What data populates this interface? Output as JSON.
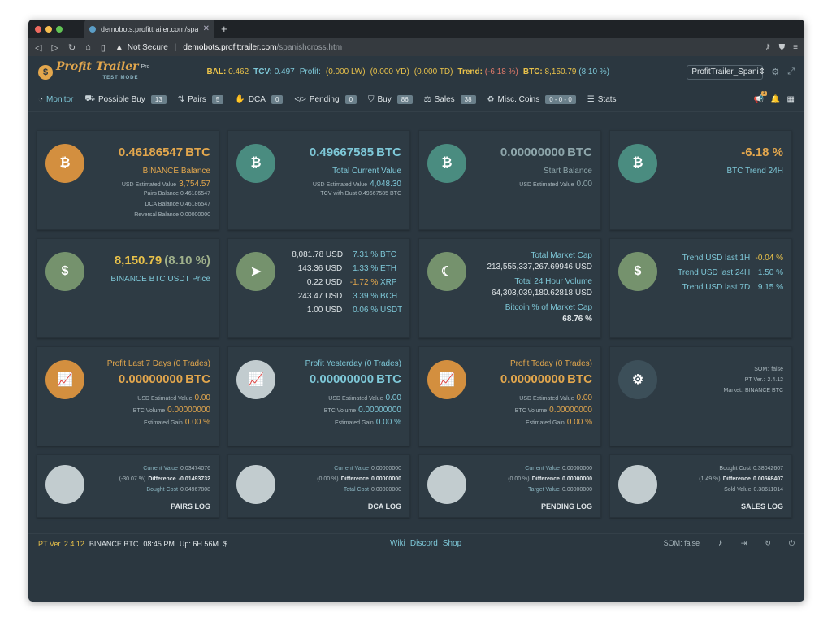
{
  "browser": {
    "tab_title": "demobots.profittrailer.com/spanis",
    "url_security": "Not Secure",
    "url_host": "demobots.profittrailer.com",
    "url_path": "/spanishcross.htm"
  },
  "header": {
    "logo_text": "Profit Trailer",
    "logo_pro": "Pro",
    "logo_sub": "TEST MODE",
    "bal_label": "BAL:",
    "bal_value": "0.462",
    "tcv_label": "TCV:",
    "tcv_value": "0.497",
    "profit_label": "Profit:",
    "profit_lw": "(0.000 LW)",
    "profit_yd": "(0.000 YD)",
    "profit_td": "(0.000 TD)",
    "trend_label": "Trend:",
    "trend_value": "(-6.18 %)",
    "btc_label": "BTC:",
    "btc_value": "8,150.79",
    "btc_change": "(8.10 %)",
    "config_select": "ProfitTrailer_Spani"
  },
  "nav": {
    "monitor": "Monitor",
    "possible_buy": "Possible Buy",
    "possible_buy_count": "13",
    "pairs": "Pairs",
    "pairs_count": "5",
    "dca": "DCA",
    "dca_count": "0",
    "pending": "Pending",
    "pending_count": "0",
    "buy": "Buy",
    "buy_count": "86",
    "sales": "Sales",
    "sales_count": "38",
    "misc": "Misc. Coins",
    "misc_count": "0 - 0 - 0",
    "stats": "Stats",
    "notif_count": "1"
  },
  "cards": {
    "binance": {
      "value": "0.46186547",
      "unit": "BTC",
      "label": "BINANCE Balance",
      "usd_label": "USD Estimated Value",
      "usd_value": "3,754.57",
      "pairs_line": "Pairs Balance 0.46186547",
      "dca_line": "DCA Balance 0.46186547",
      "reversal_line": "Reversal Balance 0.00000000"
    },
    "total": {
      "value": "0.49667585",
      "unit": "BTC",
      "label": "Total Current Value",
      "usd_label": "USD Estimated Value",
      "usd_value": "4,048.30",
      "dust_line": "TCV with Dust 0.49667585 BTC"
    },
    "start": {
      "value": "0.00000000",
      "unit": "BTC",
      "label": "Start Balance",
      "usd_label": "USD Estimated Value",
      "usd_value": "0.00"
    },
    "trend": {
      "value": "-6.18 %",
      "label": "BTC Trend 24H"
    },
    "btcprice": {
      "value": "8,150.79",
      "change": "(8.10 %)",
      "label": "BINANCE BTC USDT Price"
    },
    "market": {
      "rows": [
        {
          "usd": "8,081.78 USD",
          "pct": "7.31 %",
          "coin": "BTC"
        },
        {
          "usd": "143.36 USD",
          "pct": "1.33 %",
          "coin": "ETH"
        },
        {
          "usd": "0.22 USD",
          "pct": "-1.72 %",
          "coin": "XRP"
        },
        {
          "usd": "243.47 USD",
          "pct": "3.39 %",
          "coin": "BCH"
        },
        {
          "usd": "1.00 USD",
          "pct": "0.06 %",
          "coin": "USDT"
        }
      ]
    },
    "cap": {
      "label1": "Total Market Cap",
      "value1": "213,555,337,267.69946 USD",
      "label2": "Total 24 Hour Volume",
      "value2": "64,303,039,180.62818 USD",
      "label3": "Bitcoin % of Market Cap",
      "value3": "68.76 %"
    },
    "trendusd": {
      "rows": [
        {
          "label": "Trend USD last 1H",
          "value": "-0.04 %"
        },
        {
          "label": "Trend USD last 24H",
          "value": "1.50 %"
        },
        {
          "label": "Trend USD last 7D",
          "value": "9.15 %"
        }
      ]
    },
    "profit7": {
      "title": "Profit Last 7 Days (0 Trades)",
      "value": "0.00000000",
      "unit": "BTC",
      "usd_label": "USD Estimated Value",
      "usd_value": "0.00",
      "vol_label": "BTC Volume",
      "vol_value": "0.00000000",
      "gain_label": "Estimated Gain",
      "gain_value": "0.00 %"
    },
    "profityd": {
      "title": "Profit Yesterday (0 Trades)",
      "value": "0.00000000",
      "unit": "BTC",
      "usd_label": "USD Estimated Value",
      "usd_value": "0.00",
      "vol_label": "BTC Volume",
      "vol_value": "0.00000000",
      "gain_label": "Estimated Gain",
      "gain_value": "0.00 %"
    },
    "profittd": {
      "title": "Profit Today (0 Trades)",
      "value": "0.00000000",
      "unit": "BTC",
      "usd_label": "USD Estimated Value",
      "usd_value": "0.00",
      "vol_label": "BTC Volume",
      "vol_value": "0.00000000",
      "gain_label": "Estimated Gain",
      "gain_value": "0.00 %"
    },
    "settings": {
      "som_label": "SOM:",
      "som_value": "false",
      "ver_label": "PT Ver.:",
      "ver_value": "2.4.12",
      "market_label": "Market:",
      "market_value": "BINANCE BTC"
    },
    "pairslog": {
      "cv_label": "Current Value",
      "cv_value": "0.03474076",
      "pct": "(-30.07 %)",
      "diff_label": "Difference",
      "diff_value": "-0.01493732",
      "cost_label": "Bought Cost",
      "cost_value": "0.04967808",
      "title": "PAIRS LOG"
    },
    "dcalog": {
      "cv_label": "Current Value",
      "cv_value": "0.00000000",
      "pct": "(0.00 %)",
      "diff_label": "Difference",
      "diff_value": "0.00000000",
      "cost_label": "Total Cost",
      "cost_value": "0.00000000",
      "title": "DCA LOG"
    },
    "pendinglog": {
      "cv_label": "Current Value",
      "cv_value": "0.00000000",
      "pct": "(0.00 %)",
      "diff_label": "Difference",
      "diff_value": "0.00000000",
      "cost_label": "Target Value",
      "cost_value": "0.00000000",
      "title": "PENDING LOG"
    },
    "saleslog": {
      "cv_label": "Bought Cost",
      "cv_value": "0.38042607",
      "pct": "(1.49 %)",
      "diff_label": "Difference",
      "diff_value": "0.00568407",
      "cost_label": "Sold Value",
      "cost_value": "0.38611014",
      "title": "SALES LOG"
    }
  },
  "status": {
    "version": "PT Ver. 2.4.12",
    "market": "BINANCE BTC",
    "time": "08:45 PM",
    "uptime": "Up: 6H 56M",
    "currency": "$",
    "wiki": "Wiki",
    "discord": "Discord",
    "shop": "Shop",
    "som_label": "SOM:",
    "som_value": "false"
  },
  "colors": {
    "background": "#2b3740",
    "card": "#2e3b44",
    "accent_orange": "#e3a74d",
    "accent_teal": "#7ec8d8",
    "accent_yellow": "#e8c14a"
  }
}
